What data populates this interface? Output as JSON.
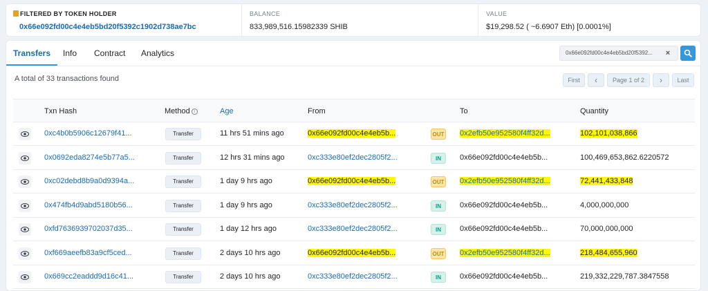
{
  "summary": {
    "filter_label": "FILTERED BY TOKEN HOLDER",
    "filter_address": "0x66e092fd00c4e4eb5bd20f5392c1902d738ae7bc",
    "balance_label": "BALANCE",
    "balance_value": "833,989,516.15982339 SHIB",
    "value_label": "VALUE",
    "value_value": "$19,298.52 ( ~6.6907 Eth) [0.0001%]"
  },
  "tabs": [
    "Transfers",
    "Info",
    "Contract",
    "Analytics"
  ],
  "search": {
    "value": "0x66e092fd00c4e4eb5bd20f5392...",
    "clear": "×"
  },
  "total_text": "A total of 33 transactions found",
  "pager": {
    "first": "First",
    "prev": "‹",
    "page": "Page 1 of 2",
    "next": "›",
    "last": "Last"
  },
  "columns": [
    "Txn Hash",
    "Method",
    "Age",
    "From",
    "To",
    "Quantity"
  ],
  "rows": [
    {
      "hash": "0xc4b0b5906c12679f41...",
      "method": "Transfer",
      "age": "11 hrs 51 mins ago",
      "from": "0x66e092fd00c4e4eb5b...",
      "dir": "OUT",
      "to": "0x2efb50e952580f4ff32d...",
      "qty": "102,101,038,866"
    },
    {
      "hash": "0x0692eda8274e5b77a5...",
      "method": "Transfer",
      "age": "12 hrs 31 mins ago",
      "from": "0xc333e80ef2dec2805f2...",
      "dir": "IN",
      "to": "0x66e092fd00c4e4eb5b...",
      "qty": "100,469,653,862.6220572"
    },
    {
      "hash": "0xc02debd8b9a0d9394a...",
      "method": "Transfer",
      "age": "1 day 9 hrs ago",
      "from": "0x66e092fd00c4e4eb5b...",
      "dir": "OUT",
      "to": "0x2efb50e952580f4ff32d...",
      "qty": "72,441,433,848"
    },
    {
      "hash": "0x474fb4d9abd5180b56...",
      "method": "Transfer",
      "age": "1 day 9 hrs ago",
      "from": "0xc333e80ef2dec2805f2...",
      "dir": "IN",
      "to": "0x66e092fd00c4e4eb5b...",
      "qty": "4,000,000,000"
    },
    {
      "hash": "0xfd7636939702037d35...",
      "method": "Transfer",
      "age": "1 day 12 hrs ago",
      "from": "0xc333e80ef2dec2805f2...",
      "dir": "IN",
      "to": "0x66e092fd00c4e4eb5b...",
      "qty": "70,000,000,000"
    },
    {
      "hash": "0xf669aeefb83a9cf5ced...",
      "method": "Transfer",
      "age": "2 days 10 hrs ago",
      "from": "0x66e092fd00c4e4eb5b...",
      "dir": "OUT",
      "to": "0x2efb50e952580f4ff32d...",
      "qty": "218,484,655,960"
    },
    {
      "hash": "0x669cc2eaddd9d16c41...",
      "method": "Transfer",
      "age": "2 days 10 hrs ago",
      "from": "0xc333e80ef2dec2805f2...",
      "dir": "IN",
      "to": "0x66e092fd00c4e4eb5b...",
      "qty": "219,332,229,787.3847558"
    }
  ],
  "colors": {
    "link": "#1a6ab3",
    "highlight": "#fff800",
    "out": "#c28b0f",
    "in": "#00a186"
  }
}
